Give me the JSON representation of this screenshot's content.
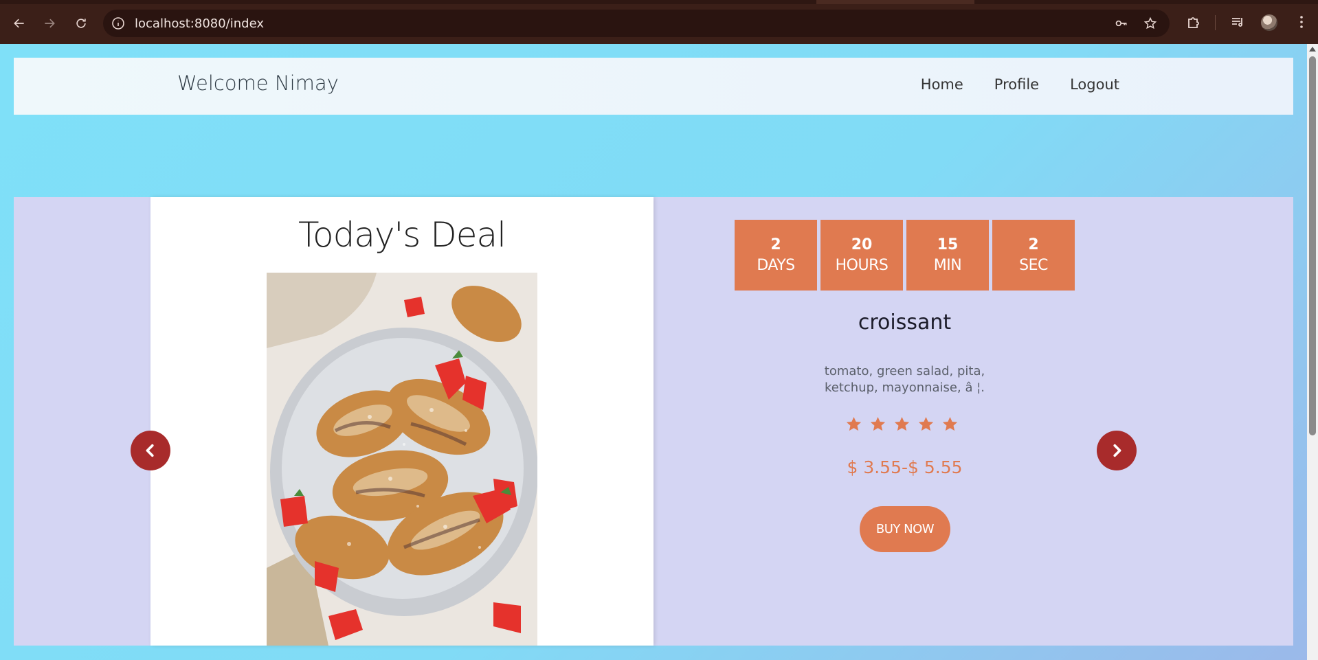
{
  "browser": {
    "url": "localhost:8080/index",
    "icons": [
      "back-icon",
      "forward-icon",
      "reload-icon",
      "site-info-icon",
      "password-key-icon",
      "bookmark-star-icon",
      "extensions-icon",
      "media-control-icon",
      "profile-avatar",
      "menu-dots-icon"
    ]
  },
  "header": {
    "welcome": "Welcome Nimay",
    "nav": {
      "home": "Home",
      "profile": "Profile",
      "logout": "Logout"
    }
  },
  "deal": {
    "title": "Today's Deal",
    "image_alt": "croissants with strawberries",
    "countdown": {
      "days": {
        "value": "2",
        "unit": "DAYS"
      },
      "hours": {
        "value": "20",
        "unit": "HOURS"
      },
      "min": {
        "value": "15",
        "unit": "MIN"
      },
      "sec": {
        "value": "2",
        "unit": "SEC"
      }
    },
    "product_name": "croissant",
    "description_line1": "tomato, green salad, pita,",
    "description_line2": "ketchup, mayonnaise, â ¦.",
    "rating": 5,
    "price": "$ 3.55-$ 5.55",
    "buy_label": "BUY NOW"
  },
  "colors": {
    "accent": "#e07a50",
    "arrow": "#a82b2b",
    "section_bg": "#d4d5f3",
    "page_bg": "#7fdcf7"
  }
}
